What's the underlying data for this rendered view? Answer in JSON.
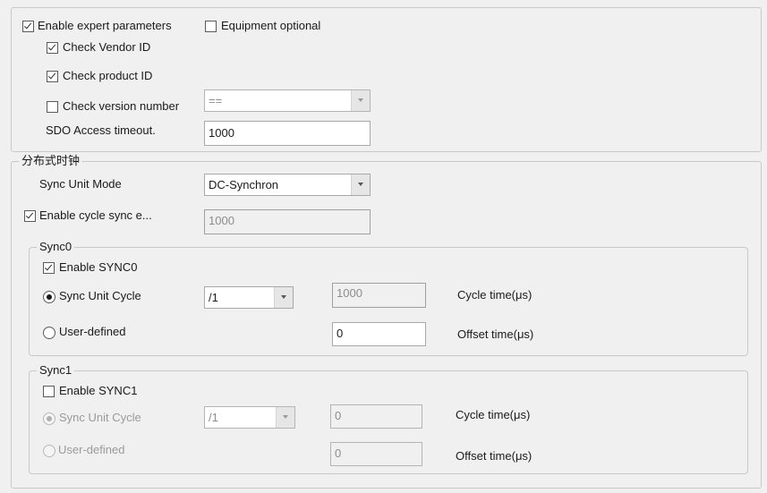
{
  "top": {
    "enable_expert": {
      "label": "Enable expert parameters",
      "checked": true
    },
    "equipment_optional": {
      "label": "Equipment optional",
      "checked": false
    },
    "check_vendor": {
      "label": "Check Vendor ID",
      "checked": true
    },
    "check_product": {
      "label": "Check product ID",
      "checked": true
    },
    "check_version": {
      "label": "Check version number",
      "checked": false
    },
    "version_op": "==",
    "sdo_label": "SDO Access timeout.",
    "sdo_value": "1000"
  },
  "dc": {
    "title": "分布式时钟",
    "sync_unit_mode_label": "Sync Unit Mode",
    "sync_unit_mode_value": "DC-Synchron",
    "enable_cycle_sync": {
      "label": "Enable cycle sync e...",
      "checked": true
    },
    "cycle_sync_value": "1000"
  },
  "sync0": {
    "title": "Sync0",
    "enable": {
      "label": "Enable SYNC0",
      "checked": true
    },
    "unit_cycle_label": "Sync Unit Cycle",
    "user_defined_label": "User-defined",
    "divider": "/1",
    "cycle_value": "1000",
    "cycle_label": "Cycle time(μs)",
    "offset_value": "0",
    "offset_label": "Offset time(μs)"
  },
  "sync1": {
    "title": "Sync1",
    "enable": {
      "label": "Enable SYNC1",
      "checked": false
    },
    "unit_cycle_label": "Sync Unit Cycle",
    "user_defined_label": "User-defined",
    "divider": "/1",
    "cycle_value": "0",
    "cycle_label": "Cycle time(μs)",
    "offset_value": "0",
    "offset_label": "Offset time(μs)"
  }
}
